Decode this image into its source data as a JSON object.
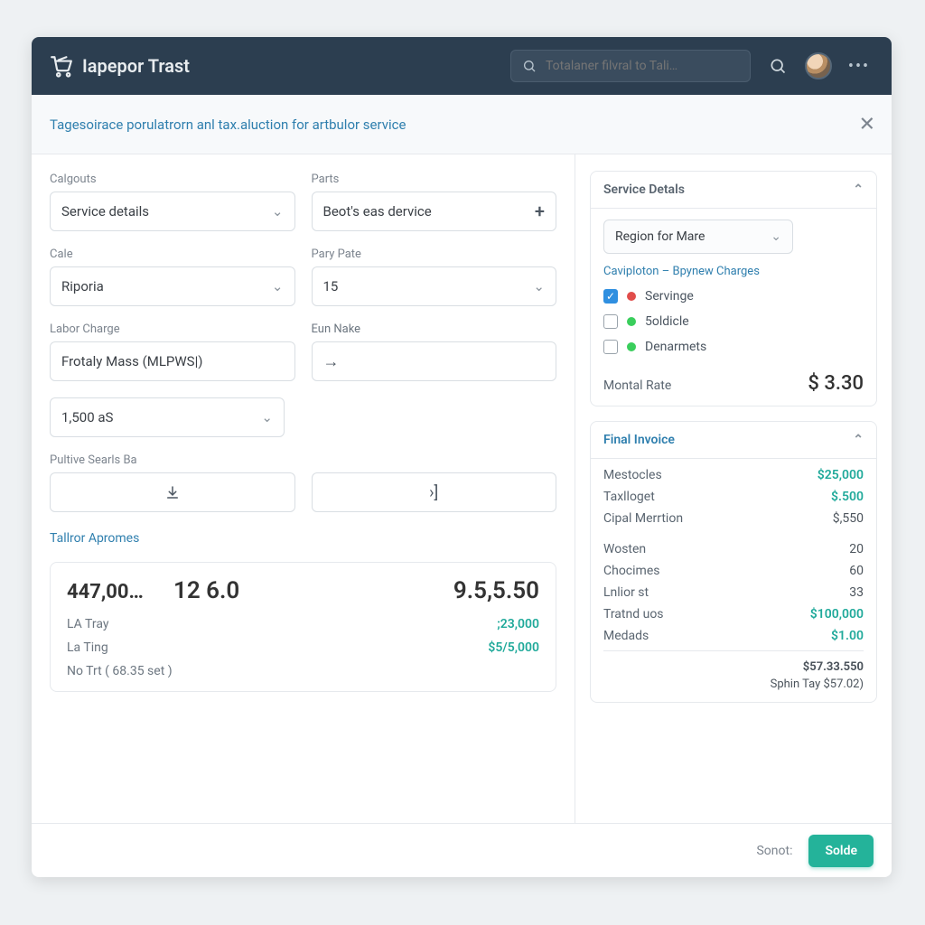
{
  "header": {
    "app_name": "Iapepor Trast",
    "search_placeholder": "Totalaner filvral to Tali…"
  },
  "subheader": {
    "title": "Tagesoirace porulatrorn anl tax.aluction for artbulor service"
  },
  "form": {
    "categories_label": "Calgouts",
    "categories_value": "Service details",
    "parts_label": "Parts",
    "parts_value": "Beot's eas dervice",
    "cale_label": "Cale",
    "cale_value": "Riporia",
    "rate_label": "Pary Pate",
    "rate_value": "15",
    "labor_label": "Labor Charge",
    "labor_value": "Frotaly Mass (MLPWS|)",
    "eun_label": "Eun Nake",
    "secondary_value": "1,500 aS",
    "seats_label": "Pultive Searls Ba"
  },
  "tailor": {
    "title": "Tallror Apromes",
    "v0": "447,00…",
    "v1": "12 6.0",
    "v2": "9.5,5.50",
    "rows": [
      {
        "k": "LA Tray",
        "v": ";23,000"
      },
      {
        "k": "La Ting",
        "v": "$5/5,000"
      },
      {
        "k": "No Trt ( 68.35 set )",
        "v": ""
      }
    ]
  },
  "service_details": {
    "title": "Service Detals",
    "region_value": "Region for Mare",
    "charges_title": "Caviploton – Bpynew Charges",
    "items": [
      {
        "checked": true,
        "dot": "red",
        "label": "Servinge"
      },
      {
        "checked": false,
        "dot": "green",
        "label": "5oldicle"
      },
      {
        "checked": false,
        "dot": "green",
        "label": "Denarmets"
      }
    ],
    "montal_label": "Montal Rate",
    "montal_value": "$ 3.30"
  },
  "invoice": {
    "title": "Final Invoice",
    "rows_top": [
      {
        "k": "Mestocles",
        "v": "$25,000",
        "style": "strong"
      },
      {
        "k": "Taxlloget",
        "v": "$.500",
        "style": "strong"
      },
      {
        "k": "Cipal Merrtion",
        "v": "$,550",
        "style": "plain"
      }
    ],
    "rows_mid": [
      {
        "k": "Wosten",
        "v": "20"
      },
      {
        "k": "Chocimes",
        "v": "60"
      },
      {
        "k": "Lnlior st",
        "v": "33"
      },
      {
        "k": "Tratnd uos",
        "v": "$100,000",
        "style": "strong"
      },
      {
        "k": "Medads",
        "v": "$1.00",
        "style": "strong"
      }
    ],
    "total1": "$57.33.550",
    "total2": "Sphin Tay  $57.02)"
  },
  "footer": {
    "secondary": "Sonot:",
    "primary": "Solde"
  }
}
